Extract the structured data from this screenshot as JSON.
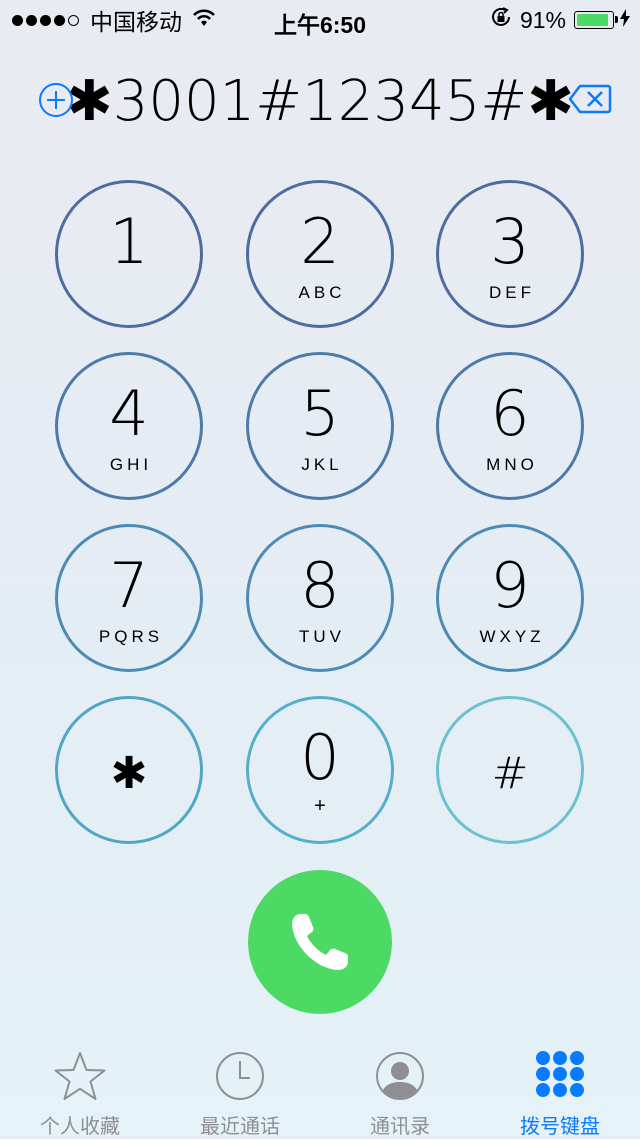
{
  "status_bar": {
    "carrier": "中国移动",
    "time": "上午6:50",
    "battery_percent": "91%",
    "battery_level": 0.91,
    "signal_bars": 4,
    "signal_total": 5
  },
  "dialer": {
    "number": "✱3001#12345#✱"
  },
  "keys": [
    {
      "digit": "1",
      "letters": ""
    },
    {
      "digit": "2",
      "letters": "ABC"
    },
    {
      "digit": "3",
      "letters": "DEF"
    },
    {
      "digit": "4",
      "letters": "GHI"
    },
    {
      "digit": "5",
      "letters": "JKL"
    },
    {
      "digit": "6",
      "letters": "MNO"
    },
    {
      "digit": "7",
      "letters": "PQRS"
    },
    {
      "digit": "8",
      "letters": "TUV"
    },
    {
      "digit": "9",
      "letters": "WXYZ"
    },
    {
      "digit": "✱",
      "letters": ""
    },
    {
      "digit": "0",
      "letters": "+"
    },
    {
      "digit": "#",
      "letters": ""
    }
  ],
  "tabs": [
    {
      "label": "个人收藏",
      "icon": "star-icon"
    },
    {
      "label": "最近通话",
      "icon": "clock-icon"
    },
    {
      "label": "通讯录",
      "icon": "contact-icon"
    },
    {
      "label": "拨号键盘",
      "icon": "keypad-icon",
      "active": true
    }
  ],
  "colors": {
    "accent": "#0a7aff",
    "call_green": "#4cd964",
    "key_ring_top": "#4a6ea1",
    "key_ring_bottom": "#5bb8cc"
  }
}
